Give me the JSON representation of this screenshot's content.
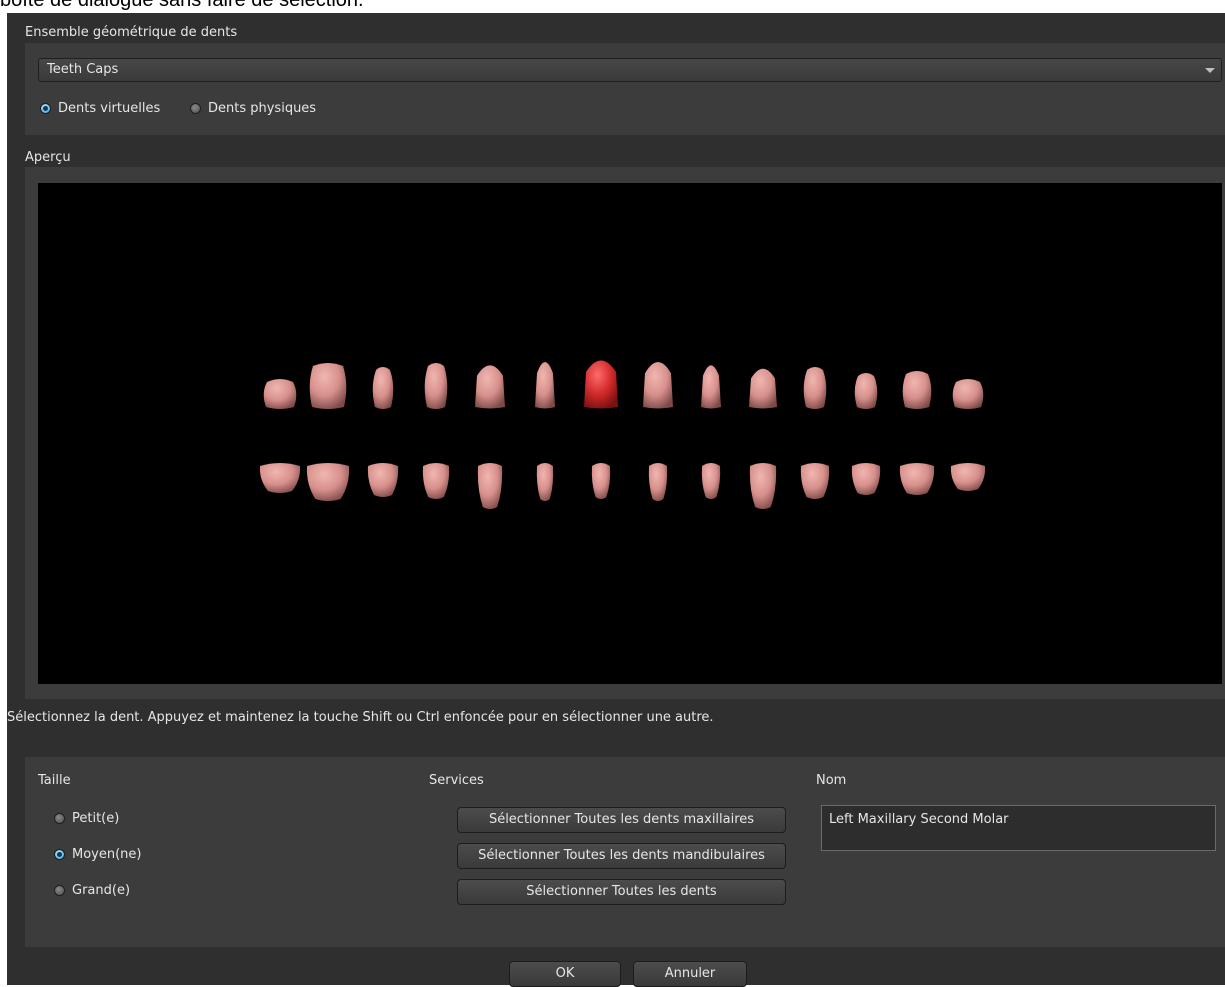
{
  "caption": "boîte de dialogue sans faire de sélection.",
  "tooth_set": {
    "group_title": "Ensemble géométrique de dents",
    "selected": "Teeth Caps",
    "radio_virtual": "Dents virtuelles",
    "radio_physical": "Dents physiques",
    "selected_mode": "virtual"
  },
  "preview": {
    "group_title": "Aperçu",
    "upper_arch_count": 14,
    "lower_arch_count": 14,
    "highlighted_tooth": "upper-7",
    "tooth_color": "#d7908c",
    "highlight_color": "#d02a2a"
  },
  "help_text": "Sélectionnez la dent. Appuyez et maintenez la touche Shift ou Ctrl enfoncée pour en sélectionner une autre.",
  "size": {
    "title": "Taille",
    "options": [
      "Petit(e)",
      "Moyen(ne)",
      "Grand(e)"
    ],
    "selected": "Moyen(ne)"
  },
  "services": {
    "title": "Services",
    "buttons": [
      "Sélectionner Toutes les dents maxillaires",
      "Sélectionner Toutes les dents mandibulaires",
      "Sélectionner Toutes les dents"
    ]
  },
  "name": {
    "title": "Nom",
    "value": "Left Maxillary Second Molar"
  },
  "dialog_buttons": {
    "ok": "OK",
    "cancel": "Annuler"
  },
  "colors": {
    "background": "#2f2f2f",
    "panel": "#3c3c3c",
    "radio_accent": "#3b9fd8"
  }
}
